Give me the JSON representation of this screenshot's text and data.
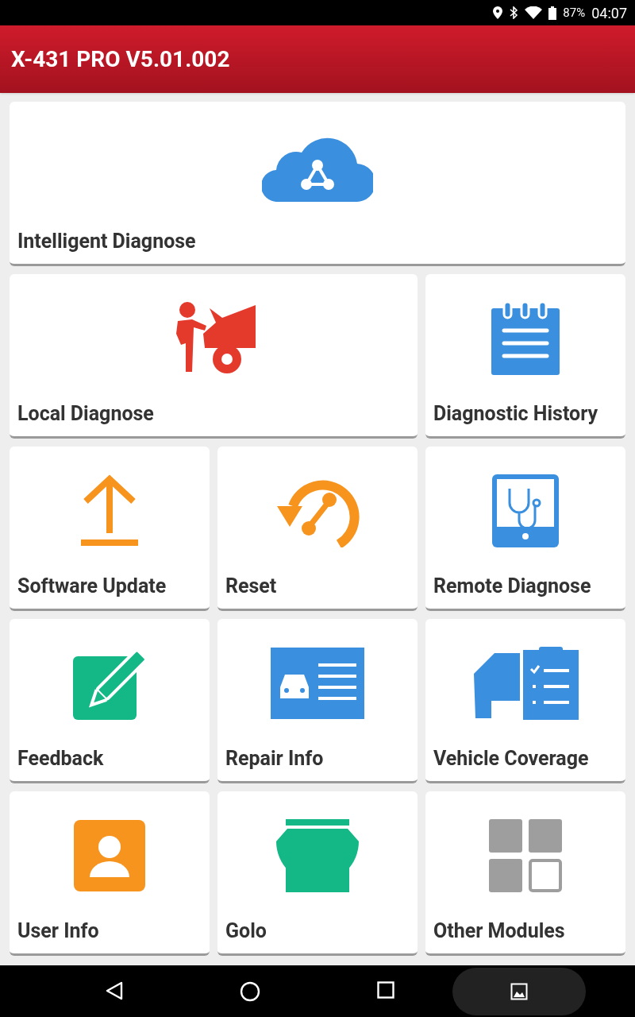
{
  "status_bar": {
    "battery": "87%",
    "time": "04:07"
  },
  "header": {
    "title": "X-431 PRO V5.01.002"
  },
  "tiles": [
    {
      "label": "Intelligent Diagnose"
    },
    {
      "label": "Local Diagnose"
    },
    {
      "label": "Diagnostic History"
    },
    {
      "label": "Software Update"
    },
    {
      "label": "Reset"
    },
    {
      "label": "Remote Diagnose"
    },
    {
      "label": "Feedback"
    },
    {
      "label": "Repair Info"
    },
    {
      "label": "Vehicle Coverage"
    },
    {
      "label": "User Info"
    },
    {
      "label": "Golo"
    },
    {
      "label": "Other Modules"
    }
  ]
}
